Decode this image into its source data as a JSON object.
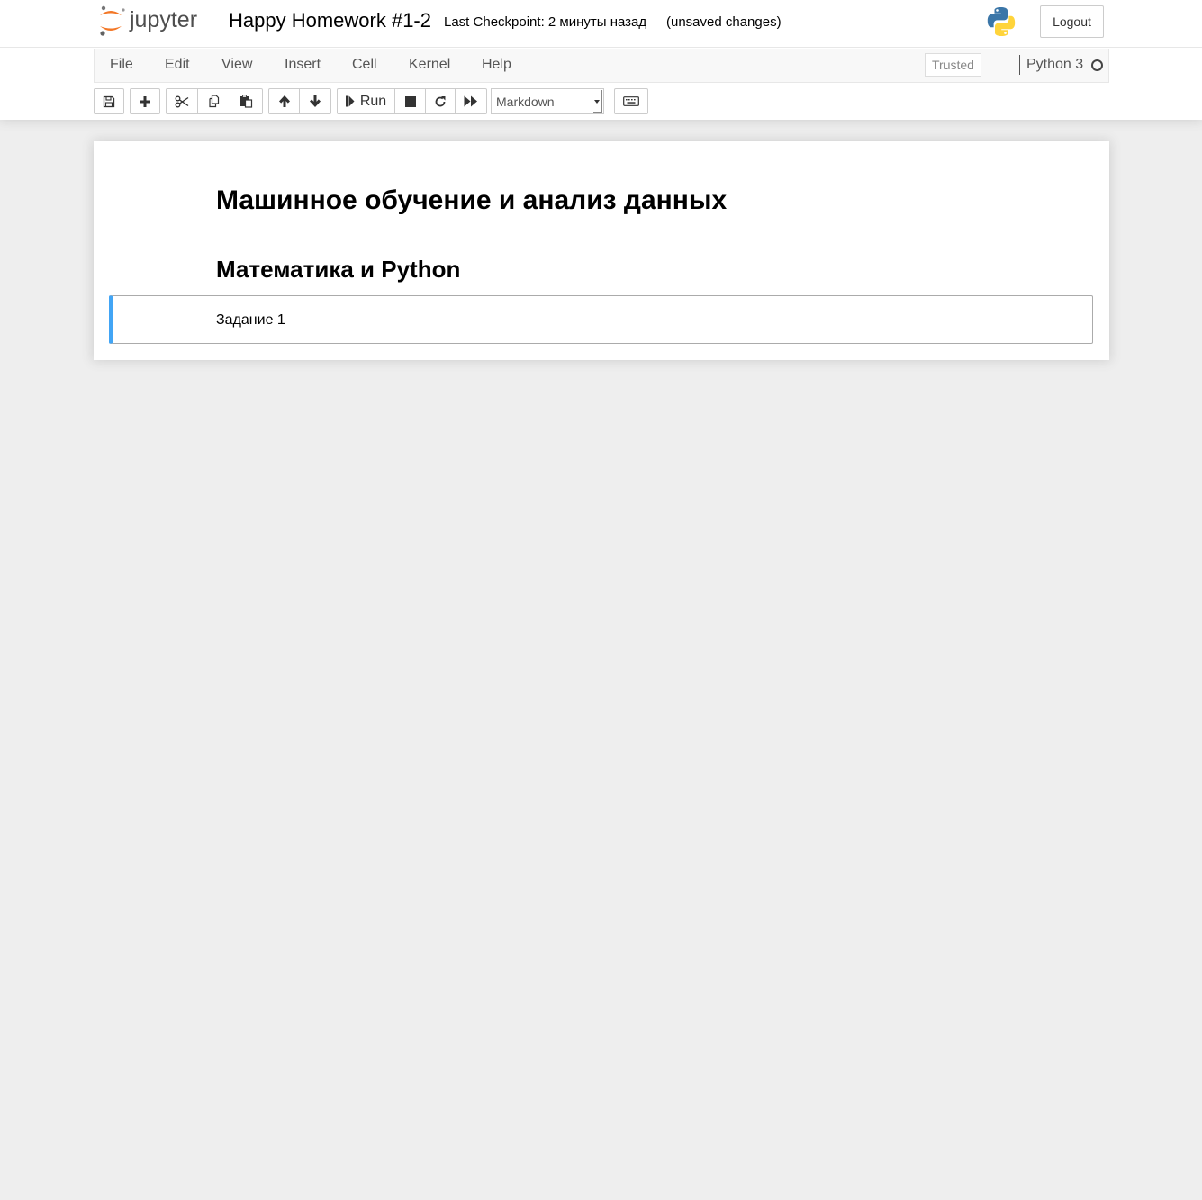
{
  "header": {
    "logo_text": "jupyter",
    "notebook_name": "Happy Homework #1-2",
    "checkpoint": "Last Checkpoint: 2 минуты назад",
    "autosave": "(unsaved changes)",
    "logout_label": "Logout"
  },
  "menubar": {
    "items": [
      "File",
      "Edit",
      "View",
      "Insert",
      "Cell",
      "Kernel",
      "Help"
    ],
    "trusted": "Trusted",
    "kernel_name": "Python 3"
  },
  "toolbar": {
    "run_label": "Run",
    "cell_type": "Markdown"
  },
  "notebook": {
    "heading1": "Машинное обучение и анализ данных",
    "heading2": "Математика и Python",
    "cell_text": "Задание 1"
  },
  "colors": {
    "selected_cell_bar": "#42a5f5",
    "jupyter_orange": "#f37726"
  }
}
